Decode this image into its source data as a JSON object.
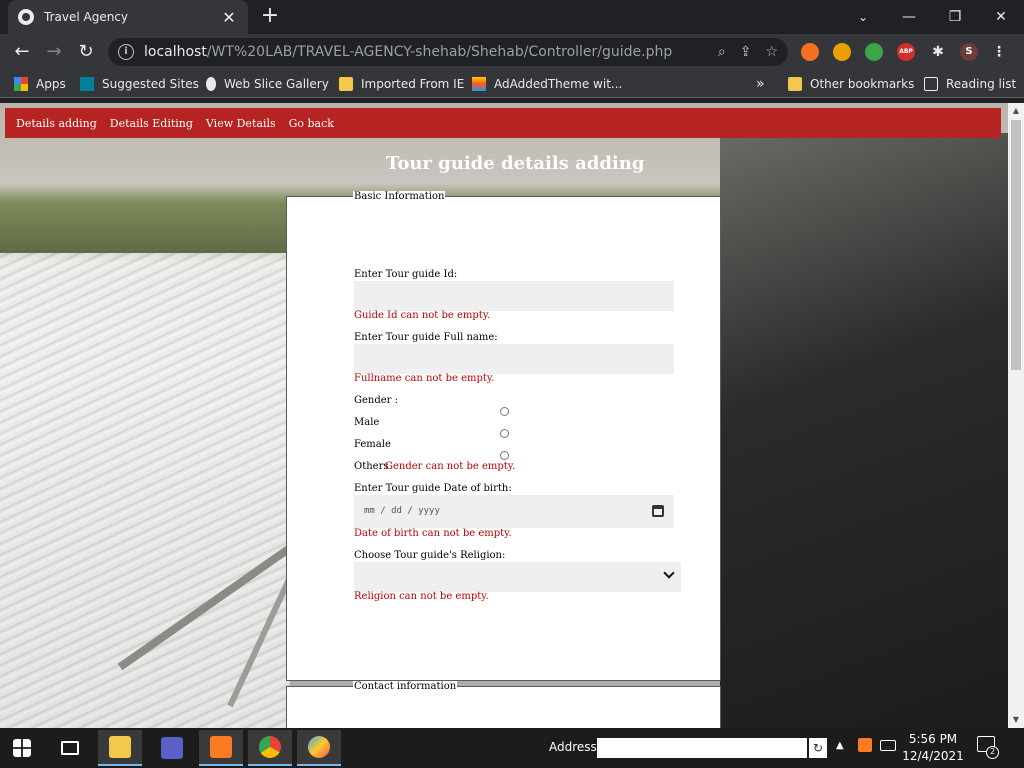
{
  "browser": {
    "tab_title": "Travel Agency",
    "tab_close": "✕",
    "new_tab": "+",
    "url_host": "localhost",
    "url_path": "/WT%20LAB/TRAVEL-AGENCY-shehab/Shehab/Controller/guide.php",
    "profile_initial": "S",
    "ext_abp": "ABP",
    "window_minimize": "—",
    "window_restore": "❐",
    "window_close": "✕"
  },
  "bookmarks": {
    "apps": "Apps",
    "suggested": "Suggested Sites",
    "webslice": "Web Slice Gallery",
    "imported": "Imported From IE",
    "adadded": "AdAddedTheme wit...",
    "overflow": "»",
    "other": "Other bookmarks",
    "reading": "Reading list"
  },
  "nav": {
    "items": [
      "Details adding",
      "Details Editing",
      "View Details",
      "Go back"
    ]
  },
  "page": {
    "heading": "Tour guide details adding",
    "fieldset1_legend": "Basic Information",
    "fieldset2_legend": "Contact information",
    "id_label": "Enter Tour guide Id:",
    "id_error": "Guide Id can not be empty.",
    "name_label": "Enter Tour guide Full name:",
    "name_error": "Fullname can not be empty.",
    "gender_label": "Gender :",
    "gender_options": [
      "Male",
      "Female",
      "Others"
    ],
    "gender_error": "Gender can not be empty.",
    "dob_label": "Enter Tour guide Date of birth:",
    "dob_placeholder": "mm / dd / yyyy",
    "dob_error": "Date of birth can not be empty.",
    "religion_label": "Choose Tour guide's Religion:",
    "religion_error": "Religion can not be empty."
  },
  "taskbar": {
    "address_label": "Address",
    "time": "5:56 PM",
    "date": "12/4/2021",
    "notifications": "2"
  }
}
